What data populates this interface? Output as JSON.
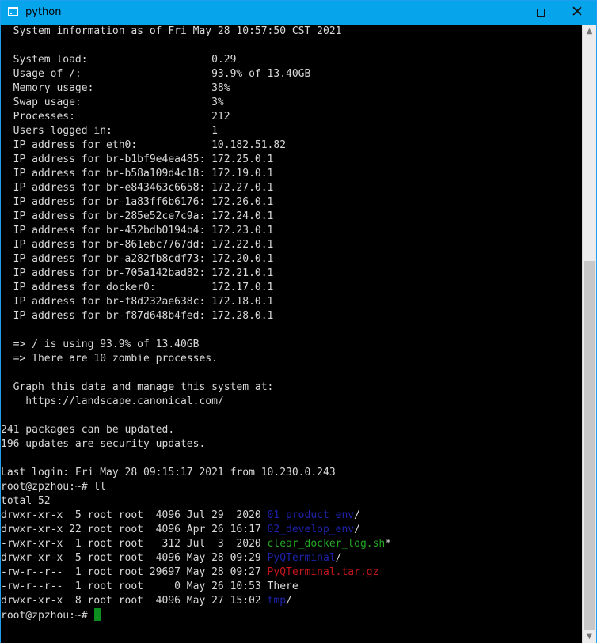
{
  "window": {
    "title": "python",
    "icons": {
      "app": "terminal-icon",
      "minimize": "minimize-icon",
      "maximize": "maximize-icon",
      "close": "close-icon"
    },
    "controls": {
      "close_glyph": "✕"
    }
  },
  "terminal": {
    "lines": [
      {
        "text": "  System information as of Fri May 28 10:57:50 CST 2021"
      },
      {
        "text": ""
      },
      {
        "text": "  System load:                    0.29"
      },
      {
        "text": "  Usage of /:                     93.9% of 13.40GB"
      },
      {
        "text": "  Memory usage:                   38%"
      },
      {
        "text": "  Swap usage:                     3%"
      },
      {
        "text": "  Processes:                      212"
      },
      {
        "text": "  Users logged in:                1"
      },
      {
        "text": "  IP address for eth0:            10.182.51.82"
      },
      {
        "text": "  IP address for br-b1bf9e4ea485: 172.25.0.1"
      },
      {
        "text": "  IP address for br-b58a109d4c18: 172.19.0.1"
      },
      {
        "text": "  IP address for br-e843463c6658: 172.27.0.1"
      },
      {
        "text": "  IP address for br-1a83ff6b6176: 172.26.0.1"
      },
      {
        "text": "  IP address for br-285e52ce7c9a: 172.24.0.1"
      },
      {
        "text": "  IP address for br-452bdb0194b4: 172.23.0.1"
      },
      {
        "text": "  IP address for br-861ebc7767dd: 172.22.0.1"
      },
      {
        "text": "  IP address for br-a282fb8cdf73: 172.20.0.1"
      },
      {
        "text": "  IP address for br-705a142bad82: 172.21.0.1"
      },
      {
        "text": "  IP address for docker0:         172.17.0.1"
      },
      {
        "text": "  IP address for br-f8d232ae638c: 172.18.0.1"
      },
      {
        "text": "  IP address for br-f87d648b4fed: 172.28.0.1"
      },
      {
        "text": ""
      },
      {
        "text": "  => / is using 93.9% of 13.40GB"
      },
      {
        "text": "  => There are 10 zombie processes."
      },
      {
        "text": ""
      },
      {
        "text": "  Graph this data and manage this system at:"
      },
      {
        "text": "    https://landscape.canonical.com/"
      },
      {
        "text": ""
      },
      {
        "text": "241 packages can be updated."
      },
      {
        "text": "196 updates are security updates."
      },
      {
        "text": ""
      },
      {
        "text": "Last login: Fri May 28 09:15:17 2021 from 10.230.0.243"
      },
      {
        "text": "root@zpzhou:~# ll"
      },
      {
        "text": "total 52"
      },
      {
        "segments": [
          {
            "text": "drwxr-xr-x  5 root root  4096 Jul 29  2020 "
          },
          {
            "text": "01_product_env",
            "color": "#1d22a9"
          },
          {
            "text": "/"
          }
        ]
      },
      {
        "segments": [
          {
            "text": "drwxr-xr-x 22 root root  4096 Apr 26 16:17 "
          },
          {
            "text": "02_develop_env",
            "color": "#1d22a9"
          },
          {
            "text": "/"
          }
        ]
      },
      {
        "segments": [
          {
            "text": "-rwxr-xr-x  1 root root   312 Jul  3  2020 "
          },
          {
            "text": "clear_docker_log.sh",
            "color": "#23a721"
          },
          {
            "text": "*"
          }
        ]
      },
      {
        "segments": [
          {
            "text": "drwxr-xr-x  5 root root  4096 May 28 09:29 "
          },
          {
            "text": "PyQTerminal",
            "color": "#1d22a9"
          },
          {
            "text": "/"
          }
        ]
      },
      {
        "segments": [
          {
            "text": "-rw-r--r--  1 root root 29697 May 28 09:27 "
          },
          {
            "text": "PyQTerminal.tar.gz",
            "color": "#c5151c"
          }
        ]
      },
      {
        "segments": [
          {
            "text": "-rw-r--r--  1 root root     0 May 26 10:53 There"
          }
        ]
      },
      {
        "segments": [
          {
            "text": "drwxr-xr-x  8 root root  4096 May 27 15:02 "
          },
          {
            "text": "tmp",
            "color": "#1d22a9"
          },
          {
            "text": "/"
          }
        ]
      },
      {
        "segments": [
          {
            "text": "root@zpzhou:~# "
          }
        ],
        "cursor": true
      }
    ]
  },
  "scrollbar": {
    "up_glyph": "▲",
    "down_glyph": "▼",
    "position": 0.58
  },
  "colors": {
    "titlebar": "#06a4eb",
    "terminal_background": "#000000",
    "terminal_text": "#d9d9d9",
    "directory": "#1d22a9",
    "executable": "#23a721",
    "archive": "#c5151c",
    "cursor": "#0d8f20"
  }
}
